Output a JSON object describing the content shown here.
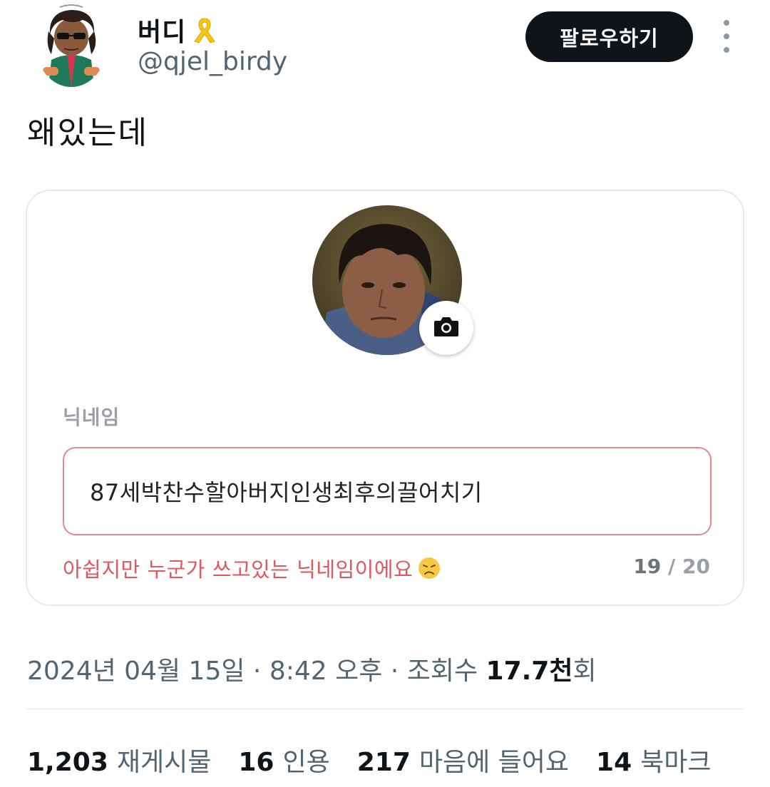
{
  "author": {
    "display_name": "버디",
    "handle": "@qjel_birdy"
  },
  "follow_button": "팔로우하기",
  "tweet_text": "왜있는데",
  "card": {
    "nickname_label": "닉네임",
    "nickname_value": "87세박찬수할아버지인생최후의끌어치기",
    "error_message": "아쉽지만 누군가 쓰고있는 닉네임이에요",
    "char_count": "19",
    "char_sep": " / ",
    "char_max": "20",
    "colors": {
      "error": "#e0575f",
      "input_border": "#e08a8f"
    }
  },
  "meta": {
    "date": "2024년 04월 15일",
    "sep1": " · ",
    "time": "8:42 오후",
    "sep2": " · ",
    "views_label": "조회수 ",
    "views_num": "17.7천",
    "views_unit": "회"
  },
  "stats": [
    {
      "num": "1,203",
      "label": "재게시물"
    },
    {
      "num": "16",
      "label": "인용"
    },
    {
      "num": "217",
      "label": "마음에 들어요"
    },
    {
      "num": "14",
      "label": "북마크"
    }
  ],
  "icons": {
    "ribbon": "yellow-ribbon-icon",
    "more": "more-vertical-icon",
    "camera": "camera-icon",
    "emoji": "sad-face-emoji-icon"
  },
  "colors": {
    "accent_dark": "#0f1419",
    "secondary_text": "#536471",
    "ribbon": "#f5c518"
  }
}
